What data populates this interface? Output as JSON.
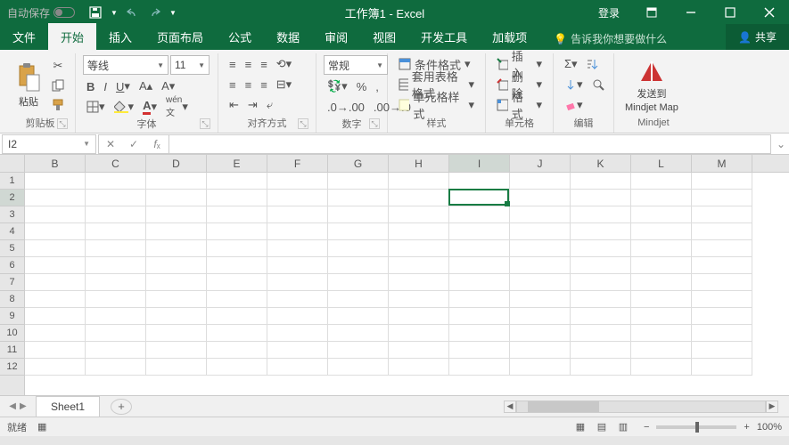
{
  "title_bar": {
    "autosave_label": "自动保存",
    "title": "工作簿1 - Excel",
    "login": "登录"
  },
  "tabs": {
    "items": [
      "文件",
      "开始",
      "插入",
      "页面布局",
      "公式",
      "数据",
      "审阅",
      "视图",
      "开发工具",
      "加载项"
    ],
    "active_index": 1,
    "tellme": "告诉我你想要做什么",
    "share": "共享"
  },
  "ribbon": {
    "clipboard": {
      "label": "剪贴板",
      "paste": "粘贴"
    },
    "font": {
      "label": "字体",
      "name": "等线",
      "size": "11"
    },
    "alignment": {
      "label": "对齐方式"
    },
    "number": {
      "label": "数字",
      "format": "常规"
    },
    "styles": {
      "label": "样式",
      "cond": "条件格式",
      "table": "套用表格格式",
      "cell": "单元格样式"
    },
    "cells": {
      "label": "单元格",
      "insert": "插入",
      "delete": "删除",
      "format": "格式"
    },
    "editing": {
      "label": "编辑"
    },
    "mindjet": {
      "label": "Mindjet",
      "send": "发送到",
      "map": "Mindjet Map"
    }
  },
  "formula_bar": {
    "name_box": "I2"
  },
  "grid": {
    "columns": [
      "B",
      "C",
      "D",
      "E",
      "F",
      "G",
      "H",
      "I",
      "J",
      "K",
      "L",
      "M"
    ],
    "rows": [
      "1",
      "2",
      "3",
      "4",
      "5",
      "6",
      "7",
      "8",
      "9",
      "10",
      "11",
      "12"
    ],
    "active_col_index": 7,
    "active_row_index": 1
  },
  "sheets": {
    "active": "Sheet1"
  },
  "status": {
    "ready": "就绪",
    "zoom": "100%"
  }
}
